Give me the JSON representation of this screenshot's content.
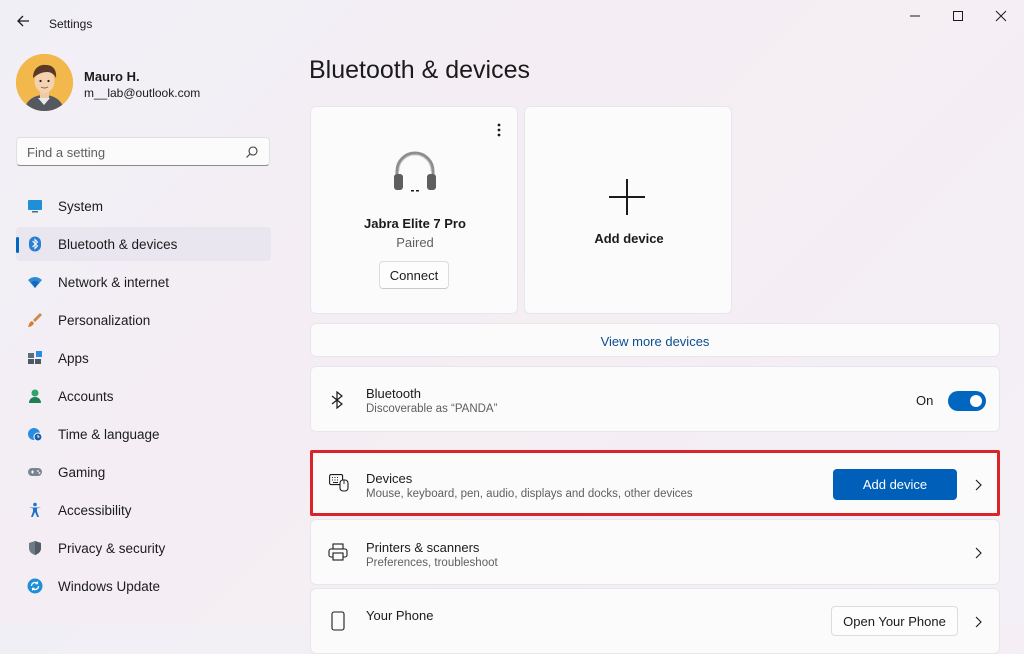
{
  "window": {
    "title": "Settings"
  },
  "user": {
    "name": "Mauro H.",
    "email": "m__lab@outlook.com"
  },
  "search": {
    "placeholder": "Find a setting"
  },
  "sidebar": {
    "items": [
      {
        "label": "System",
        "icon": "system-icon"
      },
      {
        "label": "Bluetooth & devices",
        "icon": "bluetooth-icon",
        "active": true
      },
      {
        "label": "Network & internet",
        "icon": "wifi-icon"
      },
      {
        "label": "Personalization",
        "icon": "brush-icon"
      },
      {
        "label": "Apps",
        "icon": "apps-icon"
      },
      {
        "label": "Accounts",
        "icon": "accounts-icon"
      },
      {
        "label": "Time & language",
        "icon": "globe-clock-icon"
      },
      {
        "label": "Gaming",
        "icon": "gamepad-icon"
      },
      {
        "label": "Accessibility",
        "icon": "accessibility-icon"
      },
      {
        "label": "Privacy & security",
        "icon": "shield-icon"
      },
      {
        "label": "Windows Update",
        "icon": "windows-update-icon"
      }
    ]
  },
  "main": {
    "title": "Bluetooth & devices",
    "device_card": {
      "name": "Jabra Elite 7 Pro",
      "status": "Paired",
      "connect_label": "Connect"
    },
    "add_card": {
      "label": "Add device"
    },
    "view_more": "View more devices",
    "bluetooth": {
      "title": "Bluetooth",
      "subtitle": "Discoverable as “PANDA”",
      "state_label": "On",
      "enabled": true
    },
    "devices": {
      "title": "Devices",
      "subtitle": "Mouse, keyboard, pen, audio, displays and docks, other devices",
      "button_label": "Add device"
    },
    "printers": {
      "title": "Printers & scanners",
      "subtitle": "Preferences, troubleshoot"
    },
    "phone": {
      "title": "Your Phone",
      "button_label": "Open Your Phone"
    }
  },
  "colors": {
    "accent": "#005fb8",
    "highlight_border": "#d9252a"
  }
}
